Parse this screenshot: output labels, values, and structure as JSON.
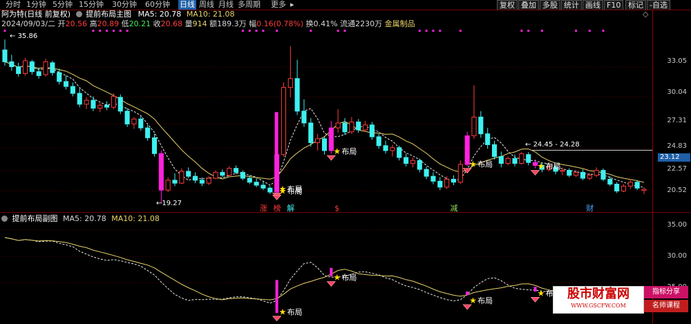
{
  "toolbar": {
    "periods": [
      {
        "label": "分时",
        "key": "fenshi"
      },
      {
        "label": "1分钟",
        "key": "1min"
      },
      {
        "label": "5分钟",
        "key": "5min"
      },
      {
        "label": "15分钟",
        "key": "15min"
      },
      {
        "label": "30分钟",
        "key": "30min"
      },
      {
        "label": "60分钟",
        "key": "60min"
      },
      {
        "label": "日线",
        "key": "daily",
        "active": true
      },
      {
        "label": "周线",
        "key": "weekly"
      },
      {
        "label": "月线",
        "key": "monthly"
      },
      {
        "label": "多周期",
        "key": "multi"
      },
      {
        "label": "更多",
        "key": "more"
      }
    ],
    "buttons": [
      "复权",
      "叠加",
      "多股",
      "统计",
      "画线",
      "F10",
      "标记",
      "-自选"
    ]
  },
  "stock": {
    "name": "阿为特",
    "mode": "(日线 前复权)",
    "indicator": "提前布局主图",
    "ma5": "MA5: 20.78",
    "ma10": "MA10: 21.08"
  },
  "quote": {
    "date": "2024/09/03/二",
    "open_label": "开",
    "open": "20.56",
    "high_label": "高",
    "high": "20.89",
    "low_label": "低",
    "low": "20.21",
    "close_label": "收",
    "close": "20.68",
    "volume_label": "量",
    "volume": "914",
    "amount_label": "额",
    "amount": "189.3万",
    "change_label": "幅",
    "change": "0.16(0.78%)",
    "turnover_label": "换",
    "turnover": "0.41%",
    "float_label": "流通",
    "float": "2230万",
    "sector": "金属制品"
  },
  "main_axis": {
    "ticks": [
      "33.05",
      "30.04",
      "27.31",
      "24.83",
      "22.57",
      "20.52"
    ],
    "current_price": "23.12",
    "high_note": "35.86",
    "low_note": "19.27",
    "range_note": "24.45 - 24.28"
  },
  "sub_pane": {
    "indicator": "提前布局副图",
    "ma5": "MA5: 20.78",
    "ma10": "MA10: 21.08",
    "ticks": [
      "35.00",
      "30.00",
      "25.00"
    ]
  },
  "signals": {
    "label": "布局",
    "markers": [
      "涨",
      "榜",
      "解",
      "$",
      "减",
      "财"
    ]
  },
  "watermark": {
    "title": "股市财富网",
    "url": "WWW.GSCFW.COM",
    "badge1": "指标分享",
    "badge2": "名师课程"
  },
  "colors": {
    "up": "#ff3b3b",
    "down": "#3ff0f0",
    "magenta": "#ff22dd",
    "ma5": "#e8e8e8",
    "ma10": "#e8d36a",
    "accent_blue": "#1e5fa8",
    "yellow": "#ffdd00"
  },
  "chart_data": {
    "type": "candlestick",
    "ylim": [
      19,
      36.5
    ],
    "sub_ylim": [
      17.5,
      37
    ],
    "candles": [
      {
        "o": 34.8,
        "h": 35.86,
        "l": 33.2,
        "c": 33.6
      },
      {
        "o": 33.6,
        "h": 34.3,
        "l": 32.7,
        "c": 33.1
      },
      {
        "o": 33.1,
        "h": 33.5,
        "l": 32.1,
        "c": 32.4
      },
      {
        "o": 32.4,
        "h": 34.0,
        "l": 32.2,
        "c": 33.7
      },
      {
        "o": 33.6,
        "h": 33.8,
        "l": 32.3,
        "c": 32.6
      },
      {
        "o": 32.6,
        "h": 33.0,
        "l": 31.9,
        "c": 32.2
      },
      {
        "o": 32.3,
        "h": 33.9,
        "l": 32.1,
        "c": 33.6
      },
      {
        "o": 33.5,
        "h": 33.7,
        "l": 32.2,
        "c": 32.5
      },
      {
        "o": 32.5,
        "h": 32.9,
        "l": 31.3,
        "c": 31.6
      },
      {
        "o": 31.6,
        "h": 32.2,
        "l": 30.8,
        "c": 31.1
      },
      {
        "o": 31.1,
        "h": 31.5,
        "l": 30.1,
        "c": 30.4
      },
      {
        "o": 30.4,
        "h": 30.9,
        "l": 29.0,
        "c": 29.3
      },
      {
        "o": 29.3,
        "h": 30.0,
        "l": 28.8,
        "c": 29.7
      },
      {
        "o": 29.7,
        "h": 30.1,
        "l": 28.6,
        "c": 28.9
      },
      {
        "o": 28.9,
        "h": 29.4,
        "l": 28.5,
        "c": 29.2
      },
      {
        "o": 29.2,
        "h": 29.6,
        "l": 28.7,
        "c": 29.0
      },
      {
        "o": 29.0,
        "h": 30.4,
        "l": 28.8,
        "c": 30.1
      },
      {
        "o": 30.0,
        "h": 30.3,
        "l": 28.3,
        "c": 28.6
      },
      {
        "o": 28.6,
        "h": 28.9,
        "l": 27.0,
        "c": 27.3
      },
      {
        "o": 27.3,
        "h": 28.0,
        "l": 26.8,
        "c": 27.8
      },
      {
        "o": 27.8,
        "h": 28.1,
        "l": 26.6,
        "c": 26.9
      },
      {
        "o": 26.9,
        "h": 27.2,
        "l": 25.6,
        "c": 25.9
      },
      {
        "o": 25.9,
        "h": 26.3,
        "l": 24.0,
        "c": 24.3
      },
      {
        "o": 24.3,
        "h": 24.6,
        "l": 19.27,
        "c": 20.6
      },
      {
        "o": 20.6,
        "h": 21.9,
        "l": 20.4,
        "c": 21.6
      },
      {
        "o": 21.6,
        "h": 22.3,
        "l": 21.0,
        "c": 21.3
      },
      {
        "o": 21.3,
        "h": 22.8,
        "l": 21.2,
        "c": 22.5
      },
      {
        "o": 22.5,
        "h": 22.9,
        "l": 21.8,
        "c": 22.0
      },
      {
        "o": 22.0,
        "h": 22.4,
        "l": 21.3,
        "c": 21.6
      },
      {
        "o": 21.6,
        "h": 21.9,
        "l": 21.0,
        "c": 21.3
      },
      {
        "o": 21.3,
        "h": 22.0,
        "l": 21.1,
        "c": 21.8
      },
      {
        "o": 21.8,
        "h": 22.6,
        "l": 21.7,
        "c": 22.4
      },
      {
        "o": 22.4,
        "h": 22.7,
        "l": 21.9,
        "c": 22.1
      },
      {
        "o": 22.1,
        "h": 23.0,
        "l": 22.0,
        "c": 22.8
      },
      {
        "o": 22.8,
        "h": 23.1,
        "l": 22.2,
        "c": 22.4
      },
      {
        "o": 22.4,
        "h": 22.6,
        "l": 21.6,
        "c": 21.8
      },
      {
        "o": 21.8,
        "h": 22.1,
        "l": 21.2,
        "c": 21.4
      },
      {
        "o": 21.4,
        "h": 21.8,
        "l": 20.9,
        "c": 21.1
      },
      {
        "o": 21.1,
        "h": 21.5,
        "l": 20.6,
        "c": 20.8
      },
      {
        "o": 20.8,
        "h": 21.0,
        "l": 20.2,
        "c": 20.4
      },
      {
        "o": 20.4,
        "h": 24.6,
        "l": 20.3,
        "c": 24.2
      },
      {
        "o": 24.2,
        "h": 31.5,
        "l": 24.0,
        "c": 31.0
      },
      {
        "o": 31.0,
        "h": 35.2,
        "l": 30.0,
        "c": 31.9
      },
      {
        "o": 31.9,
        "h": 33.8,
        "l": 28.2,
        "c": 28.6
      },
      {
        "o": 28.6,
        "h": 29.8,
        "l": 27.0,
        "c": 27.4
      },
      {
        "o": 27.4,
        "h": 27.9,
        "l": 25.0,
        "c": 25.4
      },
      {
        "o": 25.4,
        "h": 26.3,
        "l": 24.6,
        "c": 25.8
      },
      {
        "o": 25.8,
        "h": 26.0,
        "l": 24.2,
        "c": 24.6
      },
      {
        "o": 24.6,
        "h": 27.6,
        "l": 24.3,
        "c": 26.9
      },
      {
        "o": 26.9,
        "h": 28.8,
        "l": 26.4,
        "c": 27.4
      },
      {
        "o": 27.4,
        "h": 27.9,
        "l": 26.2,
        "c": 26.5
      },
      {
        "o": 26.5,
        "h": 28.0,
        "l": 26.3,
        "c": 27.5
      },
      {
        "o": 27.5,
        "h": 27.8,
        "l": 26.4,
        "c": 26.7
      },
      {
        "o": 26.7,
        "h": 27.6,
        "l": 26.5,
        "c": 27.2
      },
      {
        "o": 27.2,
        "h": 27.5,
        "l": 25.7,
        "c": 26.0
      },
      {
        "o": 26.0,
        "h": 26.3,
        "l": 24.8,
        "c": 25.1
      },
      {
        "o": 25.1,
        "h": 25.6,
        "l": 24.3,
        "c": 24.6
      },
      {
        "o": 24.6,
        "h": 25.2,
        "l": 24.0,
        "c": 24.9
      },
      {
        "o": 24.9,
        "h": 25.1,
        "l": 23.6,
        "c": 23.9
      },
      {
        "o": 23.9,
        "h": 24.3,
        "l": 23.0,
        "c": 23.3
      },
      {
        "o": 23.3,
        "h": 23.9,
        "l": 22.9,
        "c": 23.6
      },
      {
        "o": 23.6,
        "h": 23.8,
        "l": 22.4,
        "c": 22.7
      },
      {
        "o": 22.7,
        "h": 23.0,
        "l": 21.7,
        "c": 22.0
      },
      {
        "o": 22.0,
        "h": 22.4,
        "l": 21.2,
        "c": 21.5
      },
      {
        "o": 21.5,
        "h": 21.9,
        "l": 20.6,
        "c": 20.9
      },
      {
        "o": 20.9,
        "h": 22.0,
        "l": 20.7,
        "c": 21.7
      },
      {
        "o": 21.7,
        "h": 22.1,
        "l": 21.1,
        "c": 21.4
      },
      {
        "o": 21.4,
        "h": 23.6,
        "l": 21.2,
        "c": 23.2
      },
      {
        "o": 23.2,
        "h": 26.5,
        "l": 23.0,
        "c": 26.1
      },
      {
        "o": 26.1,
        "h": 31.2,
        "l": 25.8,
        "c": 28.0
      },
      {
        "o": 28.0,
        "h": 28.6,
        "l": 25.9,
        "c": 26.3
      },
      {
        "o": 26.3,
        "h": 26.9,
        "l": 24.8,
        "c": 25.2
      },
      {
        "o": 25.2,
        "h": 25.6,
        "l": 23.7,
        "c": 24.0
      },
      {
        "o": 24.0,
        "h": 24.5,
        "l": 22.9,
        "c": 23.3
      },
      {
        "o": 23.3,
        "h": 24.0,
        "l": 23.1,
        "c": 23.8
      },
      {
        "o": 23.8,
        "h": 24.2,
        "l": 23.0,
        "c": 23.3
      },
      {
        "o": 23.3,
        "h": 24.45,
        "l": 23.2,
        "c": 24.28
      },
      {
        "o": 24.2,
        "h": 24.45,
        "l": 23.1,
        "c": 23.4
      },
      {
        "o": 23.4,
        "h": 23.7,
        "l": 22.8,
        "c": 23.1
      },
      {
        "o": 23.1,
        "h": 23.4,
        "l": 22.4,
        "c": 22.7
      },
      {
        "o": 22.7,
        "h": 23.2,
        "l": 22.5,
        "c": 22.9
      },
      {
        "o": 22.9,
        "h": 23.1,
        "l": 22.2,
        "c": 22.5
      },
      {
        "o": 22.5,
        "h": 22.9,
        "l": 22.1,
        "c": 22.6
      },
      {
        "o": 22.6,
        "h": 22.8,
        "l": 21.9,
        "c": 22.1
      },
      {
        "o": 22.1,
        "h": 22.6,
        "l": 21.9,
        "c": 22.4
      },
      {
        "o": 22.4,
        "h": 22.7,
        "l": 21.6,
        "c": 21.8
      },
      {
        "o": 21.8,
        "h": 22.3,
        "l": 21.6,
        "c": 22.1
      },
      {
        "o": 22.1,
        "h": 22.9,
        "l": 21.9,
        "c": 22.6
      },
      {
        "o": 22.6,
        "h": 22.8,
        "l": 21.5,
        "c": 21.7
      },
      {
        "o": 21.7,
        "h": 22.0,
        "l": 21.0,
        "c": 21.2
      },
      {
        "o": 21.2,
        "h": 21.4,
        "l": 20.3,
        "c": 20.5
      },
      {
        "o": 20.5,
        "h": 21.2,
        "l": 20.4,
        "c": 21.0
      },
      {
        "o": 21.0,
        "h": 21.6,
        "l": 20.7,
        "c": 21.4
      },
      {
        "o": 21.4,
        "h": 21.6,
        "l": 20.6,
        "c": 20.8
      },
      {
        "o": 20.56,
        "h": 20.89,
        "l": 20.21,
        "c": 20.68
      }
    ],
    "signal_bars": [
      23,
      40,
      48,
      68,
      78
    ],
    "signal_labels": [
      40,
      48,
      68,
      78
    ],
    "event_markers": [
      {
        "i": 38,
        "text": "涨",
        "color": "#ff3b3b"
      },
      {
        "i": 40,
        "text": "榜",
        "color": "#ff3b3b"
      },
      {
        "i": 42,
        "text": "解",
        "color": "#3ff0f0"
      },
      {
        "i": 49,
        "text": "$",
        "color": "#ff3b3b"
      },
      {
        "i": 66,
        "text": "减",
        "color": "#8bdc5a"
      },
      {
        "i": 86,
        "text": "财",
        "color": "#4aa3ff"
      }
    ],
    "dot_row": [
      0,
      13,
      14,
      15,
      16,
      17,
      18,
      35,
      36,
      37,
      38,
      40,
      45,
      49,
      50,
      61,
      62,
      63,
      64,
      67,
      76,
      77,
      79,
      84,
      86,
      88
    ]
  }
}
